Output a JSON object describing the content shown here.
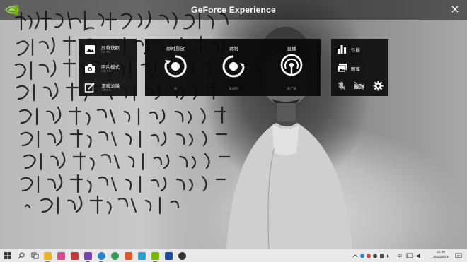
{
  "app": {
    "title": "GeForce Experience",
    "close_icon": "close-icon",
    "logo_icon": "nvidia-logo-icon"
  },
  "left_panel": {
    "items": [
      {
        "label": "屏幕快照",
        "shortcut": "Alt+F1",
        "icon": "image-icon"
      },
      {
        "label": "照片模式",
        "shortcut": "Alt+F2",
        "icon": "camera-icon"
      },
      {
        "label": "游戏滤镜",
        "shortcut": "Alt+F3",
        "icon": "filter-edit-icon"
      }
    ]
  },
  "center_panel": {
    "items": [
      {
        "title": "即时重放",
        "status": "关",
        "icon": "instant-replay-icon"
      },
      {
        "title": "录制",
        "status": "未录制",
        "icon": "record-icon"
      },
      {
        "title": "直播",
        "status": "未广播",
        "icon": "broadcast-icon"
      }
    ]
  },
  "right_panel": {
    "items": [
      {
        "label": "性能",
        "icon": "performance-bars-icon"
      },
      {
        "label": "图库",
        "icon": "gallery-icon"
      }
    ],
    "buttons": [
      "microphone-off-icon",
      "camera-off-icon",
      "settings-gear-icon"
    ]
  },
  "taskbar": {
    "clock_time": "21:45",
    "clock_date": "2022/5/21",
    "ime": "中",
    "colors": {
      "accent": "#76b900",
      "bar": "#e9e9ea"
    }
  }
}
